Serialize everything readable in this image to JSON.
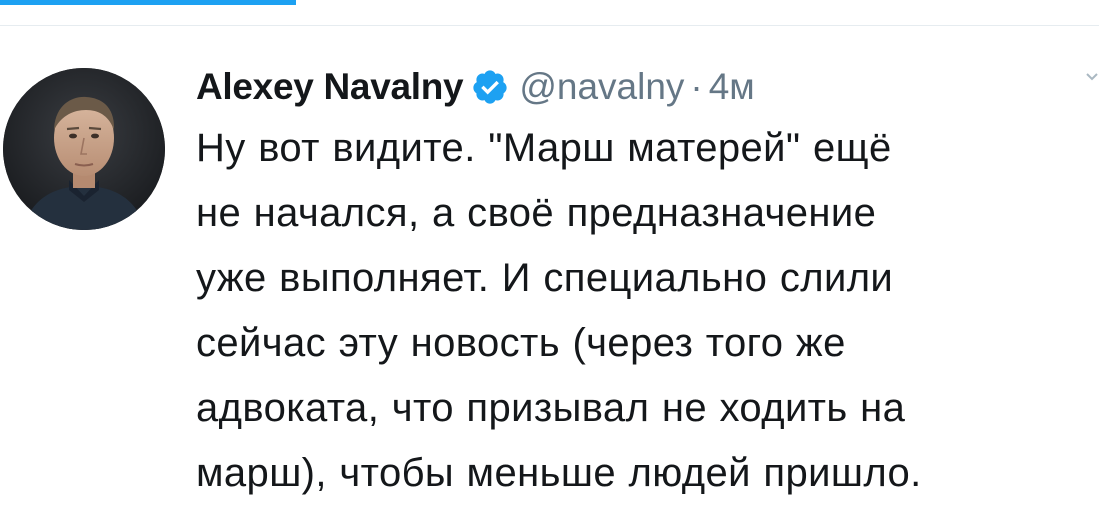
{
  "tweet": {
    "author": {
      "display_name": "Alexey Navalny",
      "handle": "@navalny",
      "verified": true
    },
    "separator": "·",
    "timestamp": "4м",
    "text_lines": [
      "Ну вот видите. \"Марш матерей\" ещё",
      "не начался, а своё предназначение",
      "уже выполняет. И специально слили",
      "сейчас эту новость (через того же",
      "адвоката, что призывал не ходить на",
      "марш), чтобы меньше людей пришло."
    ]
  },
  "colors": {
    "accent": "#1da1f2",
    "text_primary": "#14171a",
    "text_secondary": "#657786",
    "divider": "#e6ecf0"
  },
  "icons": {
    "verified": "verified-badge-icon",
    "caret": "chevron-down-icon"
  }
}
